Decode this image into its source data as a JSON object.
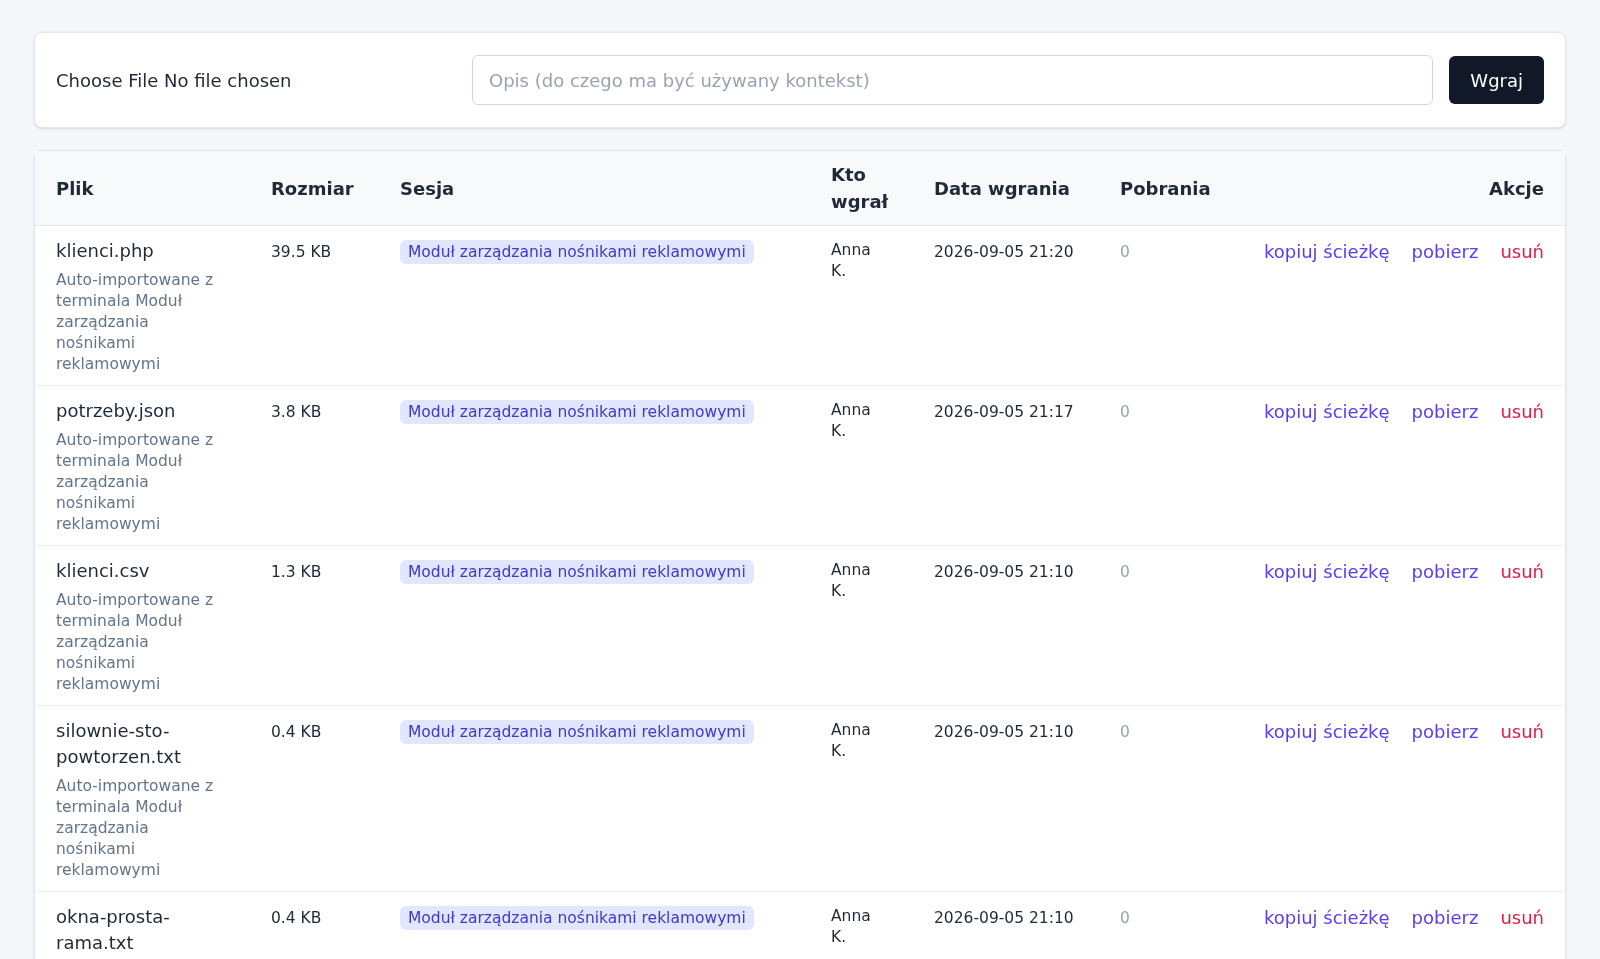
{
  "upload": {
    "file_label": "Choose File No file chosen",
    "description_placeholder": "Opis (do czego ma być używany kontekst)",
    "submit": "Wgraj"
  },
  "table": {
    "columns": [
      "Plik",
      "Rozmiar",
      "Sesja",
      "Kto wgrał",
      "Data wgrania",
      "Pobrania",
      "Akcje"
    ],
    "rows": [
      {
        "file": "klienci.php",
        "description": "Auto-importowane z terminala Moduł zarządzania nośnikami reklamowymi",
        "size": "39.5 KB",
        "session": "Moduł zarządzania nośnikami reklamowymi",
        "uploader": "Anna K.",
        "date": "2026-09-05 21:20",
        "downloads": "0",
        "actions": [
          "kopiuj ścieżkę",
          "pobierz",
          "usuń"
        ]
      },
      {
        "file": "potrzeby.json",
        "description": "Auto-importowane z terminala Moduł zarządzania nośnikami reklamowymi",
        "size": "3.8 KB",
        "session": "Moduł zarządzania nośnikami reklamowymi",
        "uploader": "Anna K.",
        "date": "2026-09-05 21:17",
        "downloads": "0",
        "actions": [
          "kopiuj ścieżkę",
          "pobierz",
          "usuń"
        ]
      },
      {
        "file": "klienci.csv",
        "description": "Auto-importowane z terminala Moduł zarządzania nośnikami reklamowymi",
        "size": "1.3 KB",
        "session": "Moduł zarządzania nośnikami reklamowymi",
        "uploader": "Anna K.",
        "date": "2026-09-05 21:10",
        "downloads": "0",
        "actions": [
          "kopiuj ścieżkę",
          "pobierz",
          "usuń"
        ]
      },
      {
        "file": "silownie-sto-powtorzen.txt",
        "description": "Auto-importowane z terminala Moduł zarządzania nośnikami reklamowymi",
        "size": "0.4 KB",
        "session": "Moduł zarządzania nośnikami reklamowymi",
        "uploader": "Anna K.",
        "date": "2026-09-05 21:10",
        "downloads": "0",
        "actions": [
          "kopiuj ścieżkę",
          "pobierz",
          "usuń"
        ]
      },
      {
        "file": "okna-prosta-rama.txt",
        "size": "0.4 KB",
        "session": "Moduł zarządzania nośnikami reklamowymi",
        "uploader": "Anna K.",
        "date": "2026-09-05 21:10",
        "downloads": "0",
        "actions": [
          "kopiuj ścieżkę",
          "pobierz",
          "usuń"
        ]
      }
    ]
  }
}
